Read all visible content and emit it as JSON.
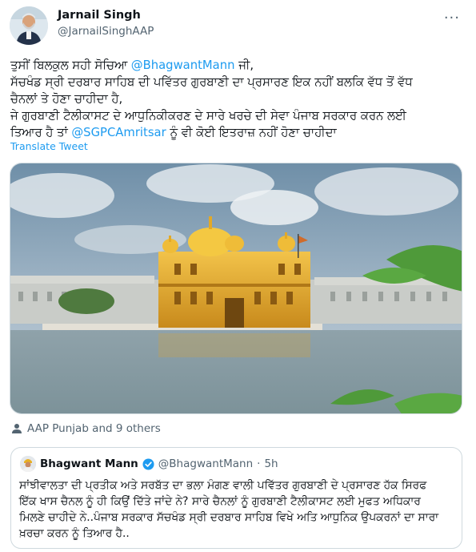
{
  "author": {
    "name": "Jarnail Singh",
    "handle": "@JarnailSinghAAP"
  },
  "more_menu_glyph": "···",
  "tweet": {
    "line1": {
      "pre": "ਤੁਸੀਂ ਬਿਲਕੁਲ ਸਹੀ ਸੋਚਿਆ ",
      "mention": "@BhagwantMann",
      "post": " ਜੀ,"
    },
    "line2": "ਸੱਚਖੰਡ ਸ੍ਰੀ ਦਰਬਾਰ ਸਾਹਿਬ ਦੀ ਪਵਿੱਤਰ ਗੁਰਬਾਣੀ ਦਾ ਪ੍ਰਸਾਰਣ ਇਕ ਨਹੀਂ ਬਲਕਿ ਵੱਧ ਤੋਂ ਵੱਧ",
    "line3": "ਚੈਨਲਾਂ ਤੇ ਹੋਣਾ ਚਾਹੀਦਾ ਹੈ,",
    "line4": "ਜੇ ਗੁਰਬਾਣੀ ਟੈਲੀਕਾਸਟ ਦੇ ਆਧੁਨਿਕੀਕਰਣ ਦੇ ਸਾਰੇ ਖਰਚੇ ਦੀ ਸੇਵਾ ਪੰਜਾਬ ਸਰਕਾਰ ਕਰਨ ਲਈ",
    "line5": {
      "pre": "ਤਿਆਰ ਹੈ ਤਾਂ ",
      "mention": "@SGPCAmritsar",
      "post": " ਨੂੰ ਵੀ ਕੋਈ ਇਤਰਾਜ਼ ਨਹੀਂ ਹੋਣਾ ਚਾਹੀਦਾ"
    }
  },
  "translate_label": "Translate Tweet",
  "likers_text": "AAP Punjab and 9 others",
  "quote": {
    "name": "Bhagwant Mann",
    "handle": "@BhagwantMann",
    "separator": "·",
    "time": "5h",
    "lines": [
      "ਸਾਂਝੀਵਾਲਤਾ ਦੀ ਪ੍ਰਤੀਕ ਅਤੇ ਸਰਬੱਤ ਦਾ ਭਲਾ ਮੰਗਣ ਵਾਲੀ ਪਵਿੱਤਰ ਗੁਰਬਾਣੀ ਦੇ ਪ੍ਰਸਾਰਣ ਹੱਕ ਸਿਰਫ",
      "ਇੱਕ ਖਾਸ ਚੈਨਲ ਨੂੰ ਹੀ ਕਿਉਂ ਦਿੱਤੇ ਜਾਂਦੇ ਨੇ? ਸਾਰੇ ਚੈਨਲਾਂ ਨੂੰ ਗੁਰਬਾਣੀ ਟੈਲੀਕਾਸਟ ਲਈ ਮੁਫਤ ਅਧਿਕਾਰ",
      "ਮਿਲਣੇ ਚਾਹੀਦੇ ਨੇ..ਪੰਜਾਬ ਸਰਕਾਰ ਸੱਚਖੰਡ ਸ੍ਰੀ ਦਰਬਾਰ ਸਾਹਿਬ ਵਿਖੇ ਅਤਿ ਆਧੁਨਿਕ ਉਪਕਰਨਾਂ ਦਾ ਸਾਰਾ",
      "ਖ਼ਰਚਾ ਕਰਨ ਨੂੰ ਤਿਆਰ ਹੈ.."
    ]
  },
  "colors": {
    "link": "#1d9bf0",
    "secondary_text": "#536471",
    "border": "#cfd9de",
    "verified": "#1d9bf0"
  }
}
